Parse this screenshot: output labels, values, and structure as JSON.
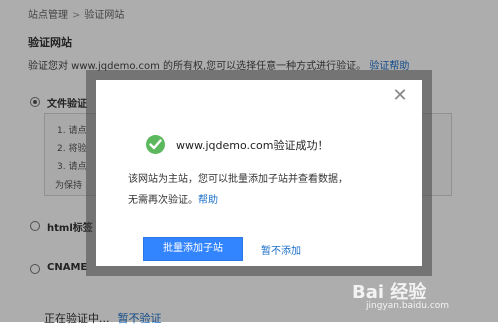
{
  "breadcrumb": {
    "parent": "站点管理",
    "separator": ">",
    "current": "验证网站"
  },
  "section_title": "验证网站",
  "description": {
    "text": "验证您对 www.jqdemo.com 的所有权,您可以选择任意一种方式进行验证。",
    "help_link": "验证帮助"
  },
  "options": [
    {
      "label": "文件验证",
      "selected": true
    },
    {
      "label": "html标签",
      "selected": false
    },
    {
      "label": "CNAME",
      "selected": false
    }
  ],
  "steps": [
    "1. 请点",
    "2. 将验",
    "3. 请点",
    "为保持"
  ],
  "footer": {
    "status": "正在验证中...",
    "cancel_link": "暂不验证"
  },
  "dialog": {
    "success_text": "www.jqdemo.com验证成功！",
    "line1": "该网站为主站，您可以批量添加子站并查看数据，",
    "line2": "无需再次验证。",
    "help_link": "帮助",
    "primary_button": "批量添加子站",
    "secondary_link": "暂不添加",
    "close_icon": "close-icon",
    "success_icon": "check-circle-icon",
    "success_color": "#5cb85c",
    "primary_color": "#3385ff"
  },
  "watermark": {
    "logo": "Bai 经验",
    "url": "jingyan.baidu.com"
  }
}
